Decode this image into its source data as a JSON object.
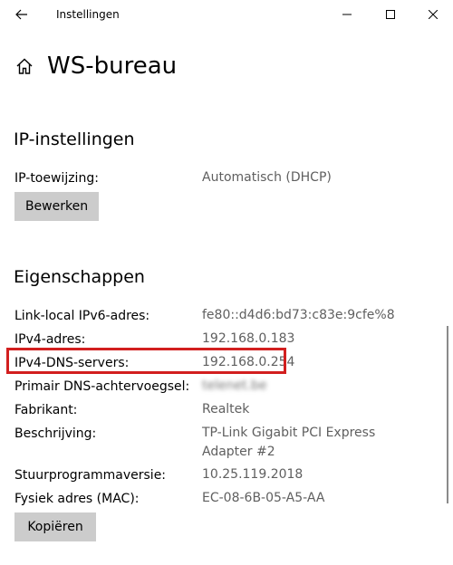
{
  "window": {
    "title": "Instellingen"
  },
  "header": {
    "title": "WS-bureau"
  },
  "ip_settings": {
    "section_title": "IP-instellingen",
    "assignment_label": "IP-toewijzing:",
    "assignment_value": "Automatisch (DHCP)",
    "edit_button": "Bewerken"
  },
  "properties": {
    "section_title": "Eigenschappen",
    "rows": [
      {
        "label": "Link-local IPv6-adres:",
        "value": "fe80::d4d6:bd73:c83e:9cfe%8"
      },
      {
        "label": "IPv4-adres:",
        "value": "192.168.0.183"
      },
      {
        "label": "IPv4-DNS-servers:",
        "value": "192.168.0.254"
      },
      {
        "label": "Primair DNS-achtervoegsel:",
        "value": "telenet.be"
      },
      {
        "label": "Fabrikant:",
        "value": "Realtek"
      },
      {
        "label": "Beschrijving:",
        "value": "TP-Link Gigabit PCI Express Adapter #2"
      },
      {
        "label": "Stuurprogrammaversie:",
        "value": "10.25.119.2018"
      },
      {
        "label": "Fysiek adres (MAC):",
        "value": "EC-08-6B-05-A5-AA"
      }
    ],
    "copy_button": "Kopiëren"
  },
  "highlight_color": "#d21f1f"
}
